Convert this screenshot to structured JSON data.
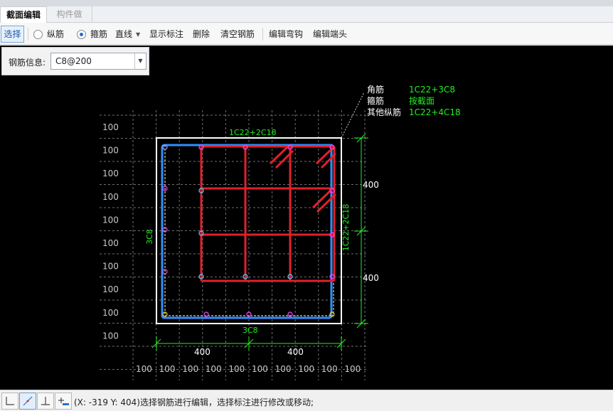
{
  "tabs": [
    {
      "label": "截面编辑",
      "active": true
    },
    {
      "label": "构件做法",
      "active": false
    }
  ],
  "toolbar": {
    "select_label": "选择",
    "radio_long": "纵筋",
    "radio_stirrup": "箍筋",
    "line_label": "直线",
    "show_dim_label": "显示标注",
    "delete_label": "删除",
    "clear_label": "清空钢筋",
    "edit_hook_label": "编辑弯钩",
    "edit_end_label": "编辑端头",
    "selected_radio": "箍筋"
  },
  "rebar_info": {
    "label": "钢筋信息:",
    "value": "C8@200"
  },
  "drawing": {
    "legend": {
      "corner_label": "角筋",
      "corner_value": "1C22+3C8",
      "stirrup_label": "箍筋",
      "stirrup_value": "按截面",
      "other_label": "其他纵筋",
      "other_value": "1C22+4C18"
    },
    "top_label": "1C22+2C18",
    "bottom_label": "3C8",
    "left_label": "3C8",
    "right_label": "1C22+2C18",
    "dim_right_upper": "400",
    "dim_right_lower": "400",
    "dim_bottom_left": "400",
    "dim_bottom_right": "400",
    "grid_step": "100",
    "colors": {
      "background": "#000000",
      "section": "#ffffff",
      "stirrup_outer": "#2f8fff",
      "stirrup_inner": "#e0202c",
      "annotation": "#22ee22",
      "grid": "#7a7a7a"
    }
  },
  "status": {
    "text": "(X: -319 Y: 404)选择钢筋进行编辑，选择标注进行修改或移动;"
  }
}
